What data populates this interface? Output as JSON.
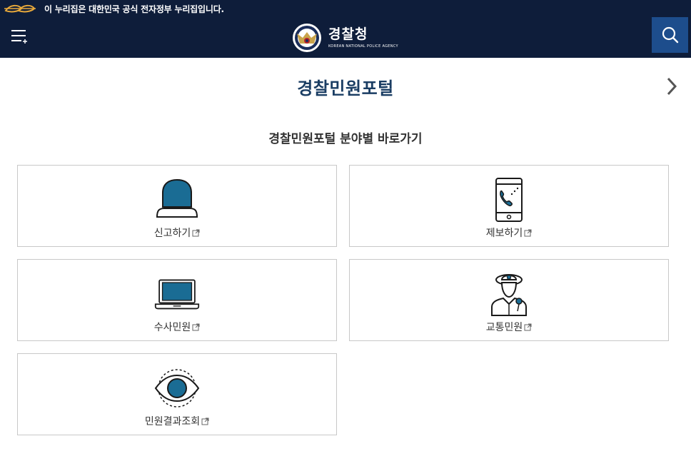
{
  "gov_bar": {
    "text": "이 누리집은 대한민국 공식 전자정부 누리집입니다."
  },
  "header": {
    "brand_title": "경찰청",
    "brand_subtitle": "KOREAN NATIONAL POLICE AGENCY",
    "menu_icon": "hamburger-menu-icon",
    "search_icon": "search-icon"
  },
  "page": {
    "title": "경찰민원포털",
    "section_title": "경찰민원포털 분야별 바로가기"
  },
  "cards": [
    {
      "label": "신고하기",
      "icon": "siren-icon"
    },
    {
      "label": "제보하기",
      "icon": "mobile-phone-icon"
    },
    {
      "label": "수사민원",
      "icon": "laptop-icon"
    },
    {
      "label": "교통민원",
      "icon": "traffic-police-icon"
    },
    {
      "label": "민원결과조회",
      "icon": "eye-icon"
    }
  ],
  "colors": {
    "header_bg": "#0e1d3a",
    "search_bg": "#1d4d8c",
    "title": "#1a3d63",
    "icon_accent": "#1a6c94",
    "card_border": "#c8c8c8"
  }
}
